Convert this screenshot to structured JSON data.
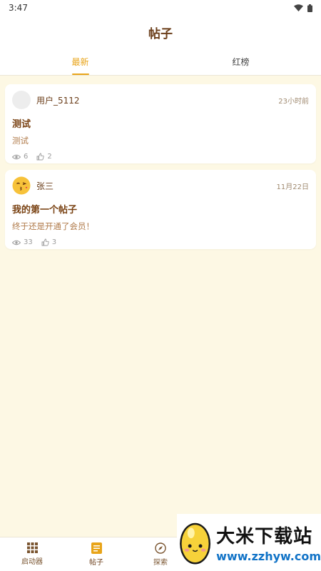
{
  "status_bar": {
    "time": "3:47"
  },
  "header": {
    "title": "帖子"
  },
  "tabs": [
    {
      "label": "最新",
      "active": true
    },
    {
      "label": "红榜",
      "active": false
    }
  ],
  "posts": [
    {
      "author": "用户_5112",
      "avatar": "blank-avatar",
      "time": "23小时前",
      "title": "测试",
      "body": "测试",
      "views": "6",
      "likes": "2"
    },
    {
      "author": "张三",
      "avatar": "kissing-face-emoji",
      "time": "11月22日",
      "title": "我的第一个帖子",
      "body": "终于还是开通了会员！",
      "views": "33",
      "likes": "3"
    }
  ],
  "bottom_nav": [
    {
      "label": "启动器",
      "icon": "grid-icon"
    },
    {
      "label": "帖子",
      "icon": "document-icon",
      "active": true
    },
    {
      "label": "探索",
      "icon": "compass-icon"
    }
  ],
  "watermark": {
    "brand": "大米下载站",
    "url": "www.zzhyw.com"
  },
  "colors": {
    "accent": "#e8a419",
    "title_brown": "#6b3e1a",
    "background": "#fdf8e4"
  }
}
